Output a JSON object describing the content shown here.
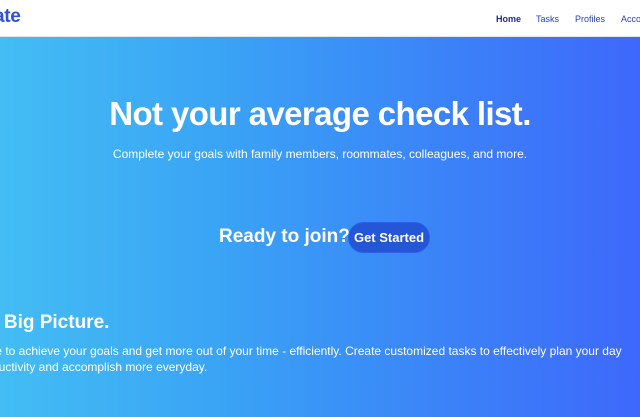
{
  "header": {
    "brand": "ate",
    "nav": [
      {
        "label": "Home",
        "active": true
      },
      {
        "label": "Tasks",
        "active": false
      },
      {
        "label": "Profiles",
        "active": false
      },
      {
        "label": "Acco",
        "active": false
      }
    ]
  },
  "hero": {
    "title": "Not your average check list.",
    "subtitle": "Complete your goals with family members, roommates, colleagues, and more.",
    "join_text": "Ready to join?",
    "cta_label": "Get Started"
  },
  "section": {
    "title": "e Big Picture.",
    "body_line1": "te to achieve your goals and get more out of your time - efficiently. Create customized tasks to effectively plan your day",
    "body_line2": "ductivity and accomplish more everyday."
  },
  "colors": {
    "gradient_start": "#43bdf4",
    "gradient_end": "#3e68fb",
    "brand": "#2f52d6",
    "cta": "#2456d6"
  }
}
